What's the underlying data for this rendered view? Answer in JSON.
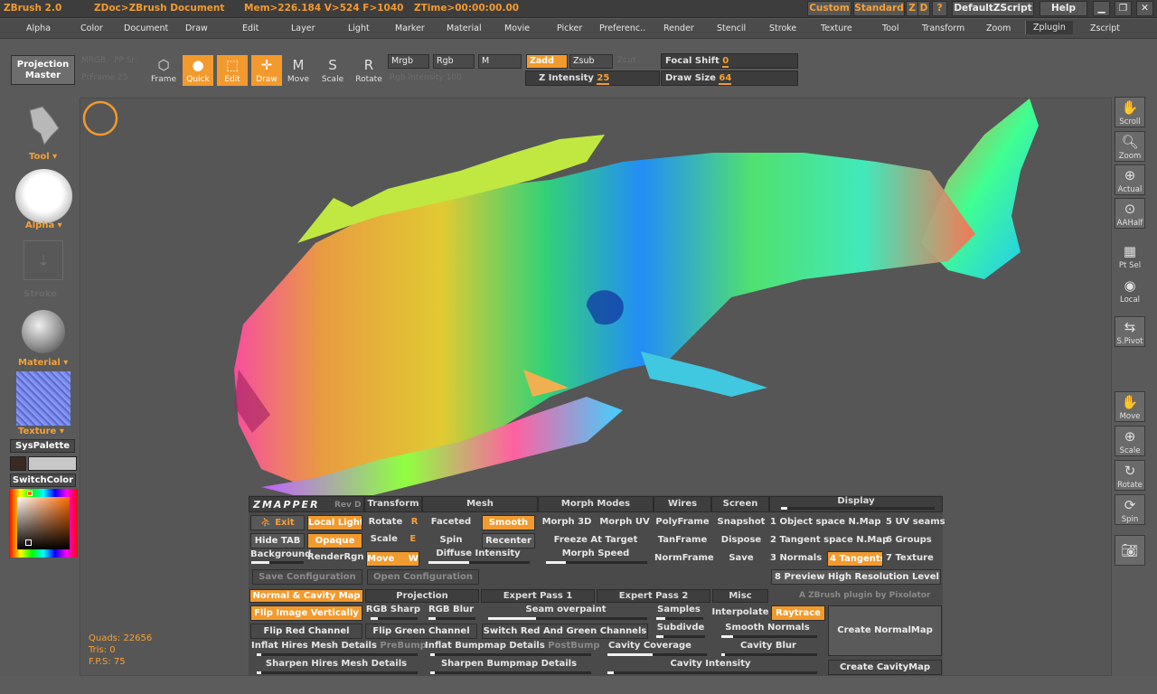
{
  "titlebar": {
    "app": "ZBrush 2.0",
    "doc": "ZDoc>ZBrush Document",
    "mem": "Mem>226.184 V>524 F>1040",
    "ztime": "ZTime>00:00:00.00",
    "custom": "Custom",
    "standard": "Standard",
    "z": "Z",
    "d": "D",
    "q": "?",
    "script": "DefaultZScript",
    "help": "Help"
  },
  "menu": [
    "Alpha",
    "Color",
    "Document",
    "Draw",
    "Edit",
    "Layer",
    "Light",
    "Marker",
    "Material",
    "Movie",
    "Picker",
    "Preferenc..",
    "Render",
    "Stencil",
    "Stroke",
    "Texture",
    "Tool",
    "Transform",
    "Zoom",
    "Zplugin",
    "Zscript"
  ],
  "toolbar": {
    "projection_master": "Projection Master",
    "ghost1": "MRGB",
    "ghost2": "PP Sr:",
    "ghost3": "PrFrame 25",
    "frame": "Frame",
    "quick": "Quick",
    "edit": "Edit",
    "draw": "Draw",
    "move": "Move",
    "scale": "Scale",
    "rotate": "Rotate",
    "mrgb": "Mrgb",
    "rgb": "Rgb",
    "m": "M",
    "zadd": "Zadd",
    "zsub": "Zsub",
    "zcut": "Zcut",
    "rgb_intensity": "Rgb Intensity 100",
    "focal_label": "Focal Shift",
    "focal_val": "0",
    "z_intensity_label": "Z Intensity",
    "z_intensity_val": "25",
    "draw_size_label": "Draw Size",
    "draw_size_val": "64"
  },
  "lefttray": {
    "tool": "Tool",
    "alpha": "Alpha",
    "stroke": "Stroke",
    "material": "Material",
    "texture": "Texture",
    "syspalette": "SysPalette",
    "switchcolor": "SwitchColor"
  },
  "stats": {
    "quads": "Quads: 22656",
    "tris": "Tris: 0",
    "fps": "F.P.S: 75"
  },
  "righttray": [
    {
      "name": "Scroll",
      "icon": "hand-icon"
    },
    {
      "name": "Zoom",
      "icon": "zoom-icon"
    },
    {
      "name": "Actual",
      "icon": "actual-icon"
    },
    {
      "name": "AAHalf",
      "icon": "aahalf-icon"
    },
    {
      "name": "Pt Sel",
      "icon": "grid-icon"
    },
    {
      "name": "Local",
      "icon": "local-icon"
    },
    {
      "name": "S.Pivot",
      "icon": "pivot-icon"
    },
    {
      "name": "Move",
      "icon": "move-icon"
    },
    {
      "name": "Scale",
      "icon": "scale-icon"
    },
    {
      "name": "Rotate",
      "icon": "rotate-icon"
    },
    {
      "name": "Spin",
      "icon": "spin-icon"
    },
    {
      "name": "",
      "icon": "camera-icon"
    }
  ],
  "zmapper": {
    "logo": "ZMAPPER",
    "rev": "Rev D",
    "hdr": {
      "transform": "Transform",
      "mesh": "Mesh",
      "morph": "Morph Modes",
      "wires": "Wires",
      "screen": "Screen",
      "display": "Display"
    },
    "exit": "Exit",
    "local_light": "Local Light",
    "hide_tab": "Hide TAB",
    "opaque": "Opaque",
    "background": "Background",
    "renderrgn": "RenderRgn",
    "rotate": "Rotate",
    "rotate_key": "R",
    "scale": "Scale",
    "scale_key": "E",
    "move": "Move",
    "move_key": "W",
    "faceted": "Faceted",
    "smooth": "Smooth",
    "spin": "Spin",
    "recenter": "Recenter",
    "diffuse": "Diffuse Intensity",
    "morph3d": "Morph 3D",
    "morphuv": "Morph UV",
    "freeze": "Freeze At Target",
    "morphspeed": "Morph Speed",
    "polyframe": "PolyFrame",
    "tanframe": "TanFrame",
    "normframe": "NormFrame",
    "snapshot": "Snapshot",
    "dispose": "Dispose",
    "save": "Save",
    "disp1": "1 Object space N.Map",
    "disp2": "2 Tangent space N.Map",
    "disp3": "3 Normals",
    "disp4": "4 Tangents",
    "disp5": "5 UV seams",
    "disp6": "6 Groups",
    "disp7": "7 Texture",
    "disp8": "8 Preview High Resolution Level",
    "save_config": "Save Configuration",
    "open_config": "Open Configuration",
    "tabs": [
      "Normal & Cavity Map",
      "Projection",
      "Expert Pass 1",
      "Expert Pass 2",
      "Misc"
    ],
    "credit": "A ZBrush plugin by Pixolator",
    "flip_image": "Flip Image Vertically",
    "rgb_sharp": "RGB Sharp",
    "rgb_blur": "RGB Blur",
    "seam_overpaint": "Seam overpaint",
    "samples": "Samples",
    "interpolate": "Interpolate",
    "raytrace": "Raytrace",
    "flip_red": "Flip Red Channel",
    "flip_green": "Flip Green Channel",
    "switch_rg": "Switch Red And Green Channels",
    "subdivide": "Subdivde",
    "smooth_normals": "Smooth Normals",
    "inflat_hires": "Inflat Hires Mesh Details",
    "prebump": "PreBump",
    "inflat_bump": "Inflat Bumpmap Details",
    "postbump": "PostBump",
    "cavity_coverage": "Cavity Coverage",
    "cavity_blur": "Cavity Blur",
    "sharpen_hires": "Sharpen Hires Mesh Details",
    "sharpen_bump": "Sharpen Bumpmap Details",
    "cavity_intensity": "Cavity Intensity",
    "create_normal": "Create NormalMap",
    "create_cavity": "Create CavityMap"
  },
  "colors": {
    "accent": "#f29a2e"
  }
}
